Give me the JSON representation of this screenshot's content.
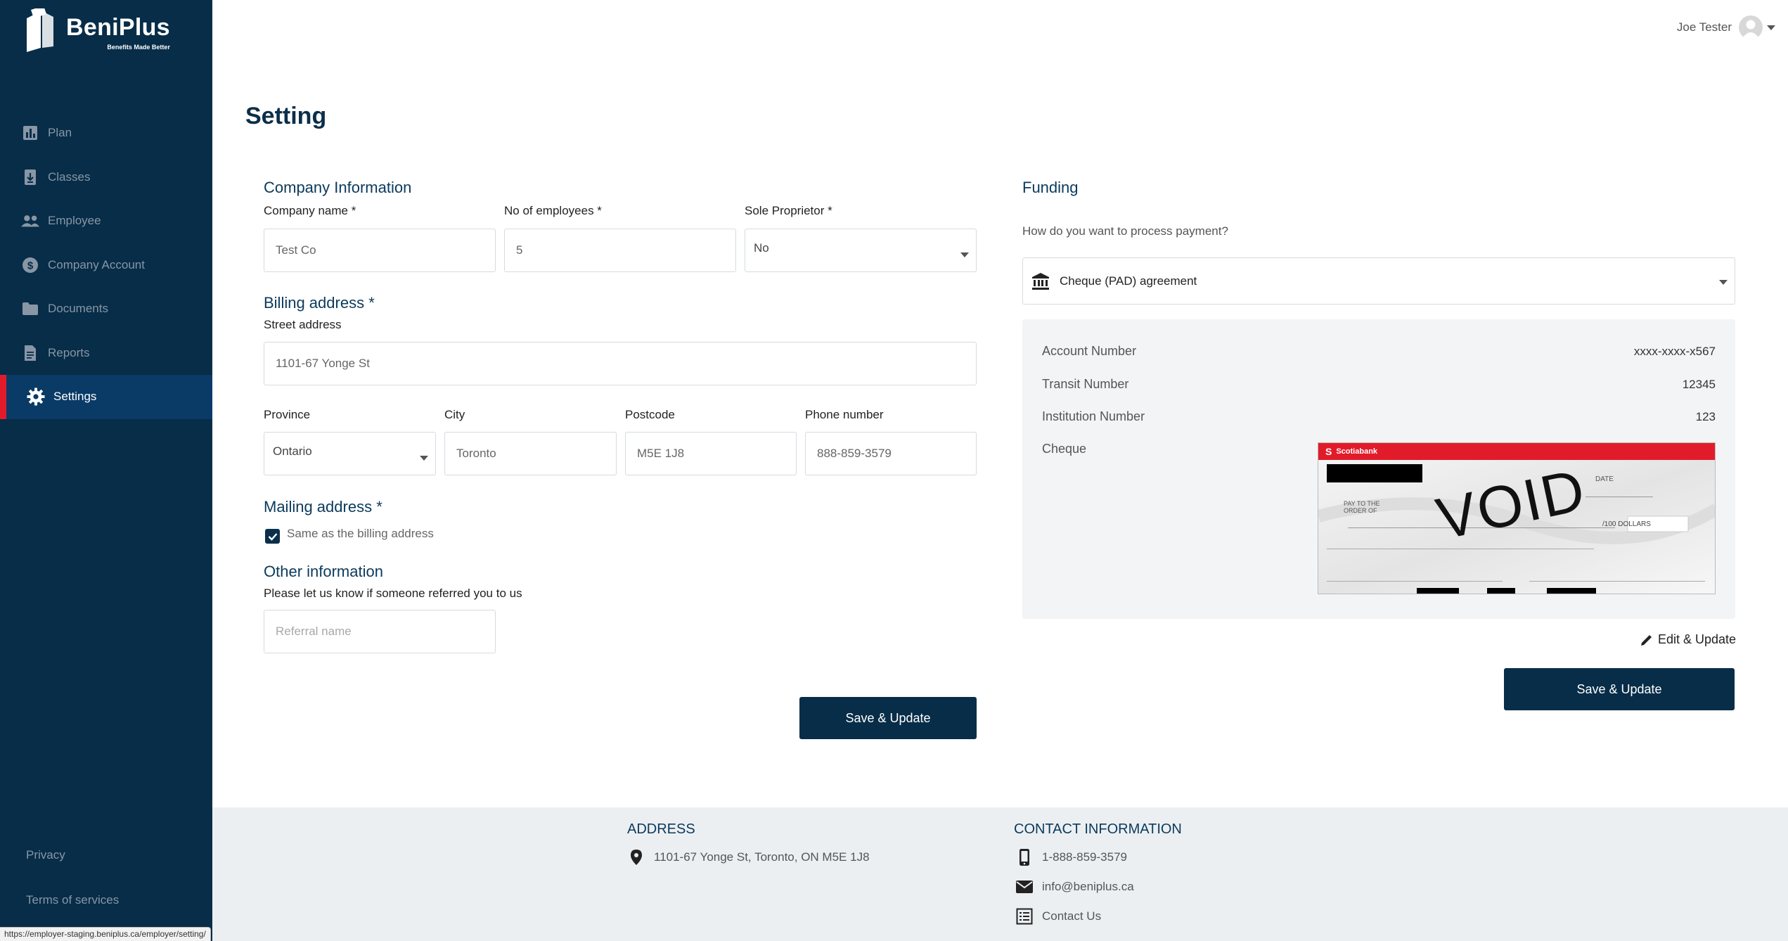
{
  "brand": {
    "name": "BeniPlus",
    "tagline": "Benefits Made Better"
  },
  "sidebar": {
    "items": [
      {
        "label": "Plan",
        "icon": "bar-chart-icon"
      },
      {
        "label": "Classes",
        "icon": "download-doc-icon"
      },
      {
        "label": "Employee",
        "icon": "people-icon"
      },
      {
        "label": "Company Account",
        "icon": "dollar-circle-icon"
      },
      {
        "label": "Documents",
        "icon": "folder-icon"
      },
      {
        "label": "Reports",
        "icon": "report-icon"
      },
      {
        "label": "Settings",
        "icon": "gear-icon",
        "active": true
      }
    ],
    "privacy": "Privacy",
    "terms": "Terms of services"
  },
  "user": {
    "name": "Joe Tester"
  },
  "page": {
    "title": "Setting"
  },
  "company": {
    "title": "Company Information",
    "name_label": "Company name *",
    "name_value": "Test Co",
    "employees_label": "No of employees *",
    "employees_value": "5",
    "sole_label": "Sole Proprietor *",
    "sole_value": "No"
  },
  "billing": {
    "title": "Billing address *",
    "street_label": "Street address",
    "street_value": "1101-67 Yonge St",
    "province_label": "Province",
    "province_value": "Ontario",
    "city_label": "City",
    "city_value": "Toronto",
    "postcode_label": "Postcode",
    "postcode_value": "M5E 1J8",
    "phone_label": "Phone number",
    "phone_value": "888-859-3579"
  },
  "mailing": {
    "title": "Mailing address *",
    "same_label": "Same as the billing address",
    "same_checked": true
  },
  "other": {
    "title": "Other information",
    "referral_label": "Please let us know if someone referred you to us",
    "referral_placeholder": "Referral name"
  },
  "left_save": "Save & Update",
  "funding": {
    "title": "Funding",
    "question": "How do you want to process payment?",
    "method": "Cheque (PAD) agreement",
    "account_label": "Account Number",
    "account_value": "xxxx-xxxx-x567",
    "transit_label": "Transit Number",
    "transit_value": "12345",
    "institution_label": "Institution Number",
    "institution_value": "123",
    "cheque_label": "Cheque",
    "cheque_bank": "Scotiabank",
    "cheque_void": "VOID",
    "cheque_date": "DATE",
    "cheque_payto": "PAY TO THE ORDER OF",
    "cheque_dollars": "/100 DOLLARS",
    "edit": "Edit & Update",
    "save": "Save & Update"
  },
  "footer": {
    "address_title": "ADDRESS",
    "address": "1101-67 Yonge St, Toronto, ON M5E 1J8",
    "contact_title": "CONTACT INFORMATION",
    "phone": "1-888-859-3579",
    "email": "info@beniplus.ca",
    "contact_us": "Contact Us"
  },
  "status_url": "https://employer-staging.beniplus.ca/employer/setting/"
}
